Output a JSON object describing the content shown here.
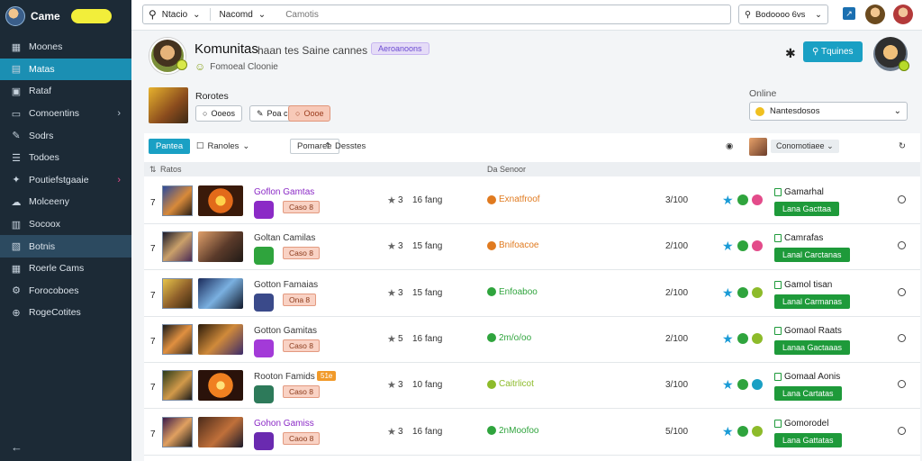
{
  "sidebar": {
    "title": "Came",
    "pill": "",
    "items": [
      {
        "label": "Moones",
        "icon": "grid-icon"
      },
      {
        "label": "Matas",
        "icon": "chart-icon"
      },
      {
        "label": "Rataf",
        "icon": "doc-icon"
      },
      {
        "label": "Comoentins",
        "icon": "folder-icon"
      },
      {
        "label": "Sodrs",
        "icon": "edit-icon"
      },
      {
        "label": "Todoes",
        "icon": "list-icon"
      },
      {
        "label": "Poutiefstgaaie",
        "icon": "puzzle-icon"
      },
      {
        "label": "Molceeny",
        "icon": "cloud-icon"
      },
      {
        "label": "Socoox",
        "icon": "table-icon"
      },
      {
        "label": "Botnis",
        "icon": "box-icon"
      },
      {
        "label": "Roerle Cams",
        "icon": "calendar-icon"
      },
      {
        "label": "Forocoboes",
        "icon": "settings-icon"
      },
      {
        "label": "RogeCotites",
        "icon": "globe-icon"
      }
    ]
  },
  "topbar": {
    "search_segment_1": "Ntacio",
    "search_segment_2": "Nacomd",
    "search_placeholder": "Camotis",
    "select_label": "Bodoooo 6vs"
  },
  "profile": {
    "name": "Komunitas",
    "subtitle": "haan tes Saine cannes",
    "tag": "Aeroanoons",
    "status": "Fomoeal Cloonie",
    "button": "Tquines"
  },
  "info": {
    "title": "Rorotes",
    "chips": [
      "Ooeos",
      "Poa cn",
      "Oooe"
    ],
    "online_label": "Online",
    "online_value": "Nantesdosos"
  },
  "toolbar": {
    "primary": "Pantea",
    "item1": "Ranoles",
    "box": "Pomaree",
    "item2": "Desstes",
    "right_box": "Conomotiaee"
  },
  "table": {
    "header_1": "Ratos",
    "header_2": "Da Senoor",
    "rows": [
      {
        "num": "7",
        "game": "Goflon Gamtas",
        "chip": "Caso 8",
        "rating": "3",
        "plays": "16 fang",
        "status": "Exnatfroof",
        "status_color": "#e07a1f",
        "time": "3/100",
        "chl_label": "Gamarhal",
        "btn": "Lana Gacttaa",
        "purple": true,
        "new": ""
      },
      {
        "num": "7",
        "game": "Goltan Camilas",
        "chip": "Caso 8",
        "rating": "3",
        "plays": "15 fang",
        "status": "Bnifoacoe",
        "status_color": "#e07a1f",
        "time": "2/100",
        "chl_label": "Camrafas",
        "btn": "Lanal Carctanas",
        "purple": false,
        "new": ""
      },
      {
        "num": "7",
        "game": "Gotton Famaias",
        "chip": "Ona 8",
        "rating": "3",
        "plays": "15 fang",
        "status": "Enfoaboo",
        "status_color": "#2fa43d",
        "time": "2/100",
        "chl_label": "Gamol tisan",
        "btn": "Lanal Carmanas",
        "purple": false,
        "new": ""
      },
      {
        "num": "7",
        "game": "Gotton Gamitas",
        "chip": "Caso 8",
        "rating": "5",
        "plays": "16 fang",
        "status": "2m/o/oo",
        "status_color": "#2fa43d",
        "time": "2/100",
        "chl_label": "Gomaol Raats",
        "btn": "Lanaa Gactaaas",
        "purple": false,
        "new": ""
      },
      {
        "num": "7",
        "game": "Rooton Famids",
        "chip": "Caso 8",
        "rating": "3",
        "plays": "10 fang",
        "status": "Caitrlicot",
        "status_color": "#8dbb2a",
        "time": "3/100",
        "chl_label": "Gomaal Aonis",
        "btn": "Lana Cartatas",
        "purple": false,
        "new": "51e"
      },
      {
        "num": "7",
        "game": "Gohon Gamiss",
        "chip": "Caoo 8",
        "rating": "3",
        "plays": "16 fang",
        "status": "2nMoofoo",
        "status_color": "#2fa43d",
        "time": "5/100",
        "chl_label": "Gomorodel",
        "btn": "Lana Gattatas",
        "purple": true,
        "new": ""
      }
    ]
  },
  "colors": {
    "accent": "#1aa0c4",
    "sidebar_bg": "#1c2a36",
    "green": "#1e9a3a"
  }
}
